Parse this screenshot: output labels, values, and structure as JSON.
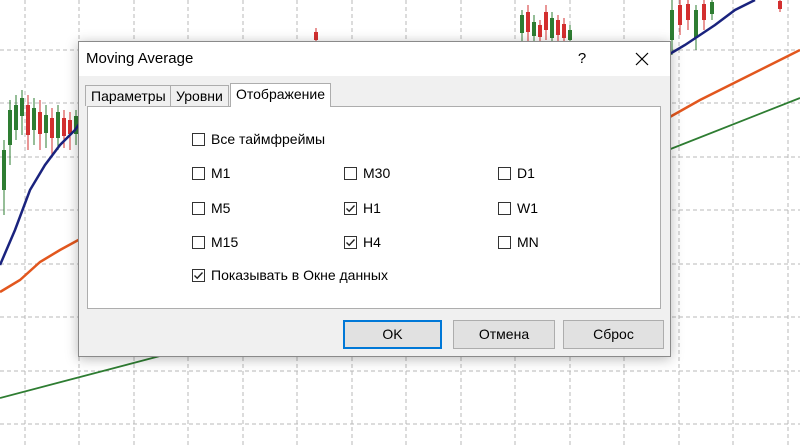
{
  "window": {
    "title": "Moving Average",
    "help_label": "?",
    "close_icon": "close-icon"
  },
  "tabs": [
    {
      "label": "Параметры",
      "active": false
    },
    {
      "label": "Уровни",
      "active": false
    },
    {
      "label": "Отображение",
      "active": true
    }
  ],
  "display": {
    "all_timeframes": {
      "label": "Все таймфреймы",
      "checked": false
    },
    "timeframes": [
      {
        "label": "M1",
        "checked": false
      },
      {
        "label": "M30",
        "checked": false
      },
      {
        "label": "D1",
        "checked": false
      },
      {
        "label": "M5",
        "checked": false
      },
      {
        "label": "H1",
        "checked": true
      },
      {
        "label": "W1",
        "checked": false
      },
      {
        "label": "M15",
        "checked": false
      },
      {
        "label": "H4",
        "checked": true
      },
      {
        "label": "MN",
        "checked": false
      }
    ],
    "show_in_data_window": {
      "label": "Показывать в Окне данных",
      "checked": true
    }
  },
  "buttons": {
    "ok": "OK",
    "cancel": "Отмена",
    "reset": "Сброс"
  },
  "colors": {
    "accent": "#0078d7",
    "ma_fast": "#1a237e",
    "ma_medium": "#e2571e",
    "ma_slow": "#2e7d32",
    "candle_bull": "#2e7d32",
    "candle_bear": "#d32f2f"
  }
}
